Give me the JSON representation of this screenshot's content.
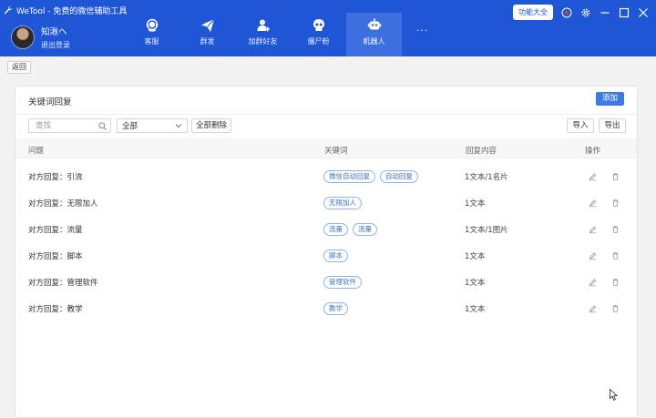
{
  "window": {
    "title": "WeTool - 免费的微信辅助工具",
    "function_button": "功能大全"
  },
  "user": {
    "name": "知湫ヘ",
    "logout": "退出登录"
  },
  "nav": {
    "items": [
      {
        "label": "客服",
        "icon": "headset-icon"
      },
      {
        "label": "群发",
        "icon": "paper-plane-icon"
      },
      {
        "label": "加群好友",
        "icon": "add-friend-icon"
      },
      {
        "label": "僵尸粉",
        "icon": "skull-icon"
      },
      {
        "label": "机器人",
        "icon": "robot-icon",
        "active": true
      }
    ],
    "more": "···"
  },
  "subbar": {
    "back": "返回"
  },
  "panel": {
    "title": "关键词回复",
    "add": "添加",
    "search_placeholder": "查找",
    "filter_value": "全部",
    "delete_all": "全部删除",
    "import": "导入",
    "export": "导出"
  },
  "table": {
    "headers": [
      "问题",
      "关键词",
      "回复内容",
      "操作"
    ],
    "rows": [
      {
        "question": "对方回复：引流",
        "keywords": [
          "微信自动回复",
          "自动回复"
        ],
        "reply": "1文本/1名片"
      },
      {
        "question": "对方回复：无限加人",
        "keywords": [
          "无限加人"
        ],
        "reply": "1文本"
      },
      {
        "question": "对方回复：流量",
        "keywords": [
          "流量",
          "流量"
        ],
        "reply": "1文本/1图片"
      },
      {
        "question": "对方回复：脚本",
        "keywords": [
          "脚本"
        ],
        "reply": "1文本"
      },
      {
        "question": "对方回复：管理软件",
        "keywords": [
          "管理软件"
        ],
        "reply": "1文本"
      },
      {
        "question": "对方回复：教学",
        "keywords": [
          "教学"
        ],
        "reply": "1文本"
      }
    ]
  },
  "colors": {
    "header_bg": "#1f56d6",
    "nav_active_bg": "#3d6fe0",
    "accent_button": "#3e7be0",
    "tag_border": "#8fb3e8",
    "tag_text": "#3e73c5"
  }
}
